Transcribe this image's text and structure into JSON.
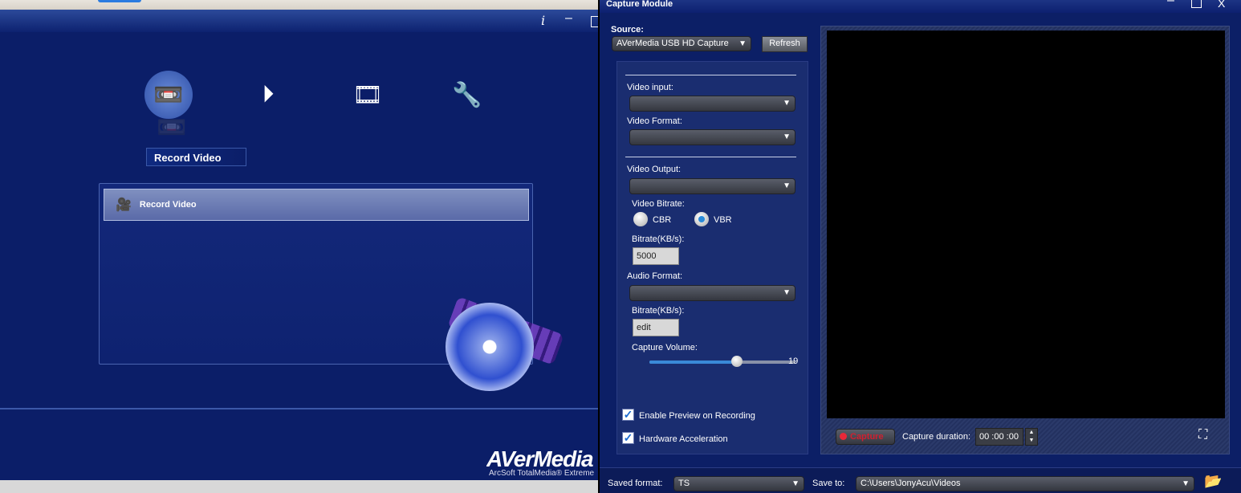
{
  "main_app": {
    "nav": [
      {
        "id": "record",
        "icon": "video-tape-icon",
        "active": true
      },
      {
        "id": "play",
        "icon": "play-icon",
        "active": false
      },
      {
        "id": "film",
        "icon": "film-strip-icon",
        "active": false
      },
      {
        "id": "settings",
        "icon": "wrench-icon",
        "active": false
      }
    ],
    "active_section_label": "Record Video",
    "panel_item_label": "Record Video",
    "logo": "AVerMedia",
    "logo_sub": "ArcSoft TotalMedia® Extreme",
    "info_glyph": "i"
  },
  "capture": {
    "title": "Capture Module",
    "source_label": "Source:",
    "source_value": "AVerMedia USB HD Capture",
    "refresh_label": "Refresh",
    "video_input_label": "Video input:",
    "video_format_label": "Video Format:",
    "video_output_label": "Video Output:",
    "video_bitrate_label": "Video Bitrate:",
    "cbr_label": "CBR",
    "vbr_label": "VBR",
    "bitrate_mode": "VBR",
    "video_bitrate_kb_label": "Bitrate(KB/s):",
    "video_bitrate_value": "5000",
    "audio_format_label": "Audio Format:",
    "audio_bitrate_label": "Bitrate(KB/s):",
    "audio_bitrate_value": "edit",
    "capture_volume_label": "Capture Volume:",
    "capture_volume_value": "19",
    "capture_volume_fraction": 0.6,
    "enable_preview_label": "Enable Preview on Recording",
    "enable_preview_checked": true,
    "hw_accel_label": "Hardware Acceleration",
    "hw_accel_checked": true,
    "capture_button": "Capture",
    "capture_duration_label": "Capture duration:",
    "capture_duration_value": "00 :00 :00",
    "saved_format_label": "Saved format:",
    "saved_format_value": "TS",
    "save_to_label": "Save to:",
    "save_to_value": "C:\\Users\\JonyAcu\\Videos"
  },
  "colors": {
    "accent": "#3a8ad8",
    "capture_red": "#e82838",
    "background": "#0b1e68"
  }
}
